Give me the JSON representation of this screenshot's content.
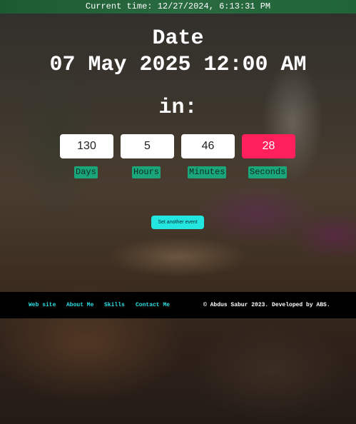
{
  "topbar": {
    "current_time": "Current time: 12/27/2024, 6:13:31 PM"
  },
  "countdown": {
    "date_label": "Date",
    "date_value": "07 May 2025 12:00 AM",
    "in_label": "in:",
    "days": "130",
    "hours": "5",
    "minutes": "46",
    "seconds": "28",
    "days_label": "Days",
    "hours_label": "Hours",
    "minutes_label": "Minutes",
    "seconds_label": "Seconds",
    "set_button_label": "Set another event"
  },
  "footer": {
    "links": [
      "Web site",
      "About Me",
      "Skills",
      "Contact Me"
    ],
    "copyright": "© Abdus Sabur 2023. Developed by ABS."
  },
  "colors": {
    "topbar": "#1f6437",
    "seconds_box": "#ff1f5a",
    "unit_badge": "#1aa57a",
    "button": "#23e6e0",
    "footer_link": "#2ce0e6"
  }
}
